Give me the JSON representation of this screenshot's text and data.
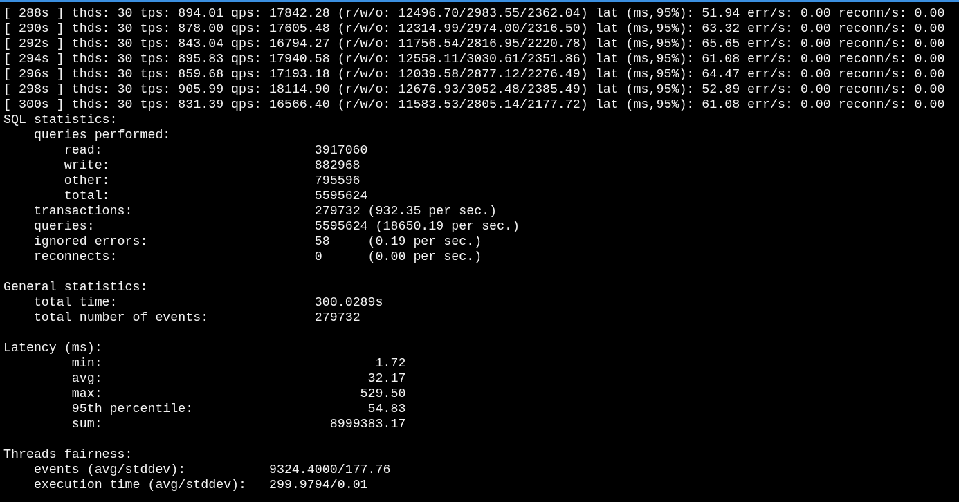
{
  "progress_lines": [
    "[ 288s ] thds: 30 tps: 894.01 qps: 17842.28 (r/w/o: 12496.70/2983.55/2362.04) lat (ms,95%): 51.94 err/s: 0.00 reconn/s: 0.00",
    "[ 290s ] thds: 30 tps: 878.00 qps: 17605.48 (r/w/o: 12314.99/2974.00/2316.50) lat (ms,95%): 63.32 err/s: 0.00 reconn/s: 0.00",
    "[ 292s ] thds: 30 tps: 843.04 qps: 16794.27 (r/w/o: 11756.54/2816.95/2220.78) lat (ms,95%): 65.65 err/s: 0.00 reconn/s: 0.00",
    "[ 294s ] thds: 30 tps: 895.83 qps: 17940.58 (r/w/o: 12558.11/3030.61/2351.86) lat (ms,95%): 61.08 err/s: 0.00 reconn/s: 0.00",
    "[ 296s ] thds: 30 tps: 859.68 qps: 17193.18 (r/w/o: 12039.58/2877.12/2276.49) lat (ms,95%): 64.47 err/s: 0.00 reconn/s: 0.00",
    "[ 298s ] thds: 30 tps: 905.99 qps: 18114.90 (r/w/o: 12676.93/3052.48/2385.49) lat (ms,95%): 52.89 err/s: 0.00 reconn/s: 0.00",
    "[ 300s ] thds: 30 tps: 831.39 qps: 16566.40 (r/w/o: 11583.53/2805.14/2177.72) lat (ms,95%): 61.08 err/s: 0.00 reconn/s: 0.00"
  ],
  "sections": [
    {
      "kind": "counters",
      "title": "SQL statistics:",
      "items": [
        {
          "label": "queries performed:",
          "children": [
            {
              "label": "read:",
              "value": "3917060"
            },
            {
              "label": "write:",
              "value": "882968"
            },
            {
              "label": "other:",
              "value": "795596"
            },
            {
              "label": "total:",
              "value": "5595624"
            }
          ]
        },
        {
          "label": "transactions:",
          "value": "279732 (932.35 per sec.)"
        },
        {
          "label": "queries:",
          "value": "5595624 (18650.19 per sec.)"
        },
        {
          "label": "ignored errors:",
          "value": "58",
          "note": "(0.19 per sec.)"
        },
        {
          "label": "reconnects:",
          "value": "0",
          "note": "(0.00 per sec.)"
        }
      ]
    },
    {
      "kind": "counters",
      "title": "General statistics:",
      "items": [
        {
          "label": "total time:",
          "value": "300.0289s"
        },
        {
          "label": "total number of events:",
          "value": "279732"
        }
      ]
    },
    {
      "kind": "latency",
      "title": "Latency (ms):",
      "items": [
        {
          "label": "min:",
          "value": "1.72"
        },
        {
          "label": "avg:",
          "value": "32.17"
        },
        {
          "label": "max:",
          "value": "529.50"
        },
        {
          "label": "95th percentile:",
          "value": "54.83"
        },
        {
          "label": "sum:",
          "value": "8999383.17"
        }
      ]
    },
    {
      "kind": "fairness",
      "title": "Threads fairness:",
      "items": [
        {
          "label": "events (avg/stddev):",
          "value": "9324.4000/177.76"
        },
        {
          "label": "execution time (avg/stddev):",
          "value": "299.9794/0.01"
        }
      ]
    }
  ]
}
